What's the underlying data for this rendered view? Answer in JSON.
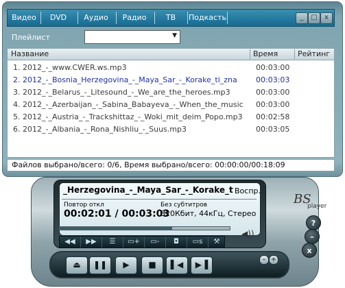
{
  "tabs": [
    {
      "label": "Видео"
    },
    {
      "label": "DVD"
    },
    {
      "label": "Аудио"
    },
    {
      "label": "Радио"
    },
    {
      "label": "ТВ"
    },
    {
      "label": "Подкасть"
    }
  ],
  "window_controls": {
    "minimize": "_",
    "maximize": "□",
    "close": "x"
  },
  "playlist": {
    "label": "Плейлист",
    "selected": ""
  },
  "columns": {
    "name": "Название",
    "time": "Время",
    "rating": "Рейтинг"
  },
  "tracks": [
    {
      "title": "1. 2012_-_www.CWER.ws.mp3",
      "duration": "00:03:00"
    },
    {
      "title": "2. 2012_-_Bosnia_Herzegovina_-_Maya_Sar_-_Korake_ti_zna",
      "duration": "00:03:03",
      "active": true
    },
    {
      "title": "3. 2012_-_Belarus_-_Litesound_-_We_are_the_heroes.mp3",
      "duration": "00:03:00"
    },
    {
      "title": "4. 2012_-_Azerbaijan_-_Sabina_Babayeva_-_When_the_music",
      "duration": "00:03:00"
    },
    {
      "title": "5. 2012_-_Austria_-_Trackshittaz_-_Woki_mit_deim_Popo.mp3",
      "duration": "00:02:58"
    },
    {
      "title": "6. 2012_-_Albania_-_Rona_Nishliu_-_Suus.mp3",
      "duration": "00:03:05"
    }
  ],
  "status": "Файлов выбрано/всего: 0/6, Время выбрано/всего: 00:00:00/00:18:09",
  "player": {
    "title_scroll": "_Herzegovina_-_Maya_Sar_-_Korake_ti_zn",
    "mode": "Воспр.",
    "repeat": "Повтор откл",
    "time": "00:02:01 / 00:03:03",
    "subtitles": "Без субтитров",
    "format": "320Кбит, 44кГц, Стерео",
    "progress_fraction": 0.66
  },
  "logo": {
    "brand": "BS",
    "sub": "player"
  },
  "side_buttons": {
    "help": "?",
    "minimize": "–",
    "close": "x"
  },
  "transport_zoom": {
    "minus": "–",
    "plus": "+"
  }
}
